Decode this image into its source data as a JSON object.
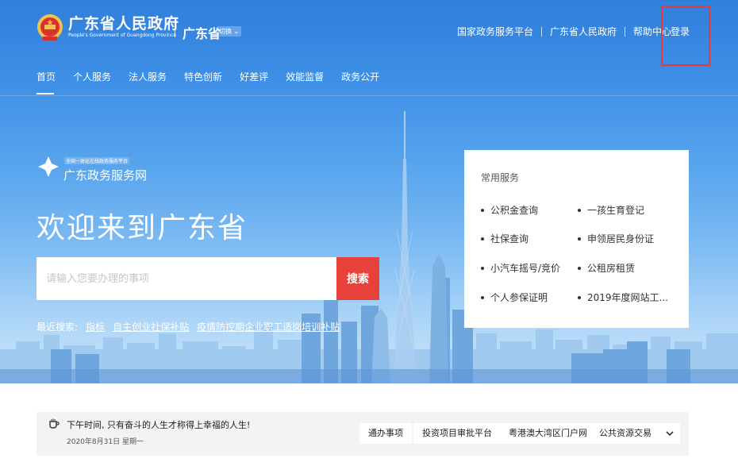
{
  "header": {
    "title": "广东省人民政府",
    "subtitle": "People's Government of Guangdong Province",
    "region": "广东省",
    "region_switch": "切换",
    "links": [
      "国家政务服务平台",
      "广东省人民政府",
      "帮助中心"
    ],
    "login": "登录"
  },
  "nav": {
    "items": [
      "首页",
      "个人服务",
      "法人服务",
      "特色创新",
      "好差评",
      "效能监督",
      "政务公开"
    ],
    "active_index": 0
  },
  "platform": {
    "tag": "全国一体化在线政务服务平台",
    "name": "广东政务服务网"
  },
  "hero": {
    "welcome": "欢迎来到广东省"
  },
  "search": {
    "placeholder": "请输入您要办理的事项",
    "button": "搜索"
  },
  "recent": {
    "label": "最近搜索:",
    "items": [
      "指标",
      "自主创业社保补贴",
      "疫情防控期企业职工适岗培训补贴"
    ]
  },
  "services": {
    "title": "常用服务",
    "items": [
      "公积金查询",
      "一孩生育登记",
      "社保查询",
      "申领居民身份证",
      "小汽车摇号/竞价",
      "公租房租赁",
      "个人参保证明",
      "2019年度网站工..."
    ]
  },
  "bottom": {
    "greeting": "下午时间, 只有奋斗的人生才称得上幸福的人生!",
    "date": "2020年8月31日 星期一",
    "quick_links": [
      "通办事项",
      "投资项目审批平台",
      "粤港澳大湾区门户网",
      "公共资源交易"
    ]
  },
  "colors": {
    "primary_blue": "#2f7fdc",
    "search_red": "#e8413b",
    "login_highlight": "#e23b3b"
  }
}
